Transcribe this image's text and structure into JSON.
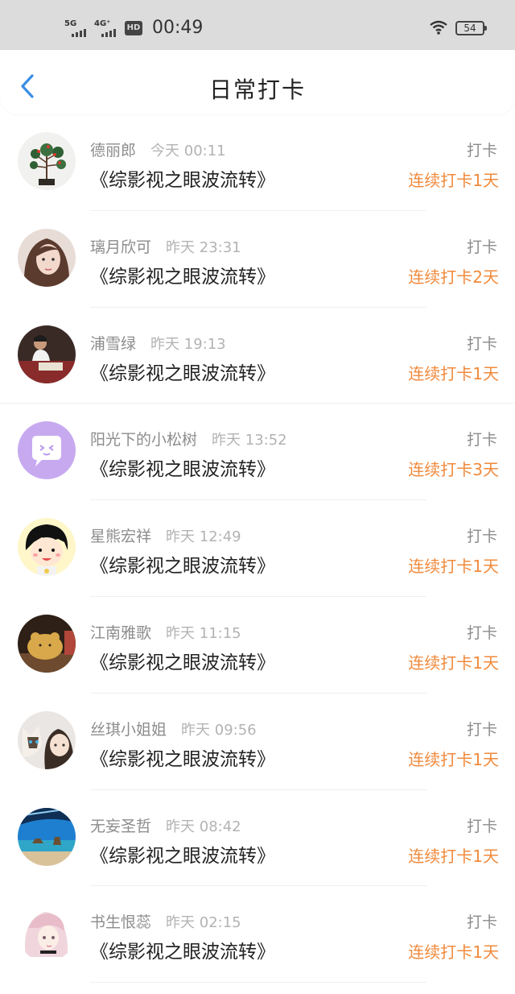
{
  "status_bar": {
    "signal1": "5G",
    "signal2": "4G⁺",
    "hd": "HD",
    "time": "00:49",
    "battery": "54"
  },
  "header": {
    "title": "日常打卡",
    "back_icon": "chevron-left-icon",
    "accent_color": "#3a8ee6"
  },
  "colors": {
    "streak": "#f08a3c"
  },
  "checkins": [
    {
      "user": "德丽郎",
      "time": "今天 00:11",
      "book": "《综影视之眼波流转》",
      "tag": "打卡",
      "streak": "连续打卡1天"
    },
    {
      "user": "璃月欣可",
      "time": "昨天 23:31",
      "book": "《综影视之眼波流转》",
      "tag": "打卡",
      "streak": "连续打卡2天"
    },
    {
      "user": "浦雪绿",
      "time": "昨天 19:13",
      "book": "《综影视之眼波流转》",
      "tag": "打卡",
      "streak": "连续打卡1天"
    },
    {
      "user": "阳光下的小松树",
      "time": "昨天 13:52",
      "book": "《综影视之眼波流转》",
      "tag": "打卡",
      "streak": "连续打卡3天"
    },
    {
      "user": "星熊宏祥",
      "time": "昨天 12:49",
      "book": "《综影视之眼波流转》",
      "tag": "打卡",
      "streak": "连续打卡1天"
    },
    {
      "user": "江南雅歌",
      "time": "昨天 11:15",
      "book": "《综影视之眼波流转》",
      "tag": "打卡",
      "streak": "连续打卡1天"
    },
    {
      "user": "丝琪小姐姐",
      "time": "昨天 09:56",
      "book": "《综影视之眼波流转》",
      "tag": "打卡",
      "streak": "连续打卡1天"
    },
    {
      "user": "无妄圣哲",
      "time": "昨天 08:42",
      "book": "《综影视之眼波流转》",
      "tag": "打卡",
      "streak": "连续打卡1天"
    },
    {
      "user": "书生恨蕊",
      "time": "昨天 02:15",
      "book": "《综影视之眼波流转》",
      "tag": "打卡",
      "streak": "连续打卡1天"
    }
  ]
}
